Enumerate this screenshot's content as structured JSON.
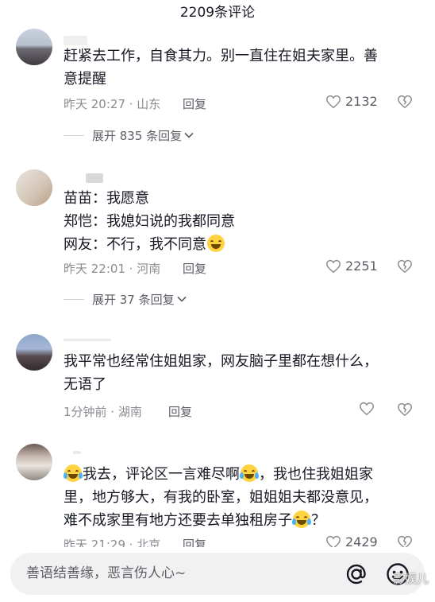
{
  "header": {
    "title": "2209条评论"
  },
  "comments": [
    {
      "lines": [
        "赶紧去工作，自食其力。别一直住在姐夫家里。善",
        "意提醒"
      ],
      "time": "昨天 20:27 · 山东",
      "reply": "回复",
      "likes": "2132",
      "expand": "展开 835 条回复"
    },
    {
      "lines": [
        "苗苗：我愿意",
        "郑恺：我媳妇说的我都同意",
        "网友：不行，我不同意"
      ],
      "time": "昨天 22:01 · 河南",
      "reply": "回复",
      "likes": "2251",
      "expand": "展开 37 条回复"
    },
    {
      "lines": [
        "我平常也经常住姐姐家，网友脑子里都在想什么，",
        "无语了"
      ],
      "time": "1分钟前 · 湖南",
      "reply": "回复",
      "likes": ""
    },
    {
      "line1_a": "我去，评论区一言难尽啊",
      "line1_b": "，我也住我姐姐家",
      "lines": [
        "里，地方够大，有我的卧室，姐姐姐夫都没意见，",
        "难不成家里有地方还要去单独租房子"
      ],
      "line3_end": "？",
      "time": "昨天 21:29 · 北京",
      "reply": "回复",
      "likes": "2429"
    }
  ],
  "input": {
    "placeholder": "善语结善缘，恶言伤人心~"
  },
  "watermark": "影娱儿",
  "icons": {
    "like": "heart-outline-icon",
    "dislike": "broken-heart-icon",
    "at": "at-sign-icon",
    "emoji": "emoji-face-icon",
    "expand": "chevron-down-icon"
  },
  "colors": {
    "text": "#161823",
    "meta": "#8a8b91",
    "input_bg": "#f1f1f2",
    "emoji": "#ffd23f"
  }
}
